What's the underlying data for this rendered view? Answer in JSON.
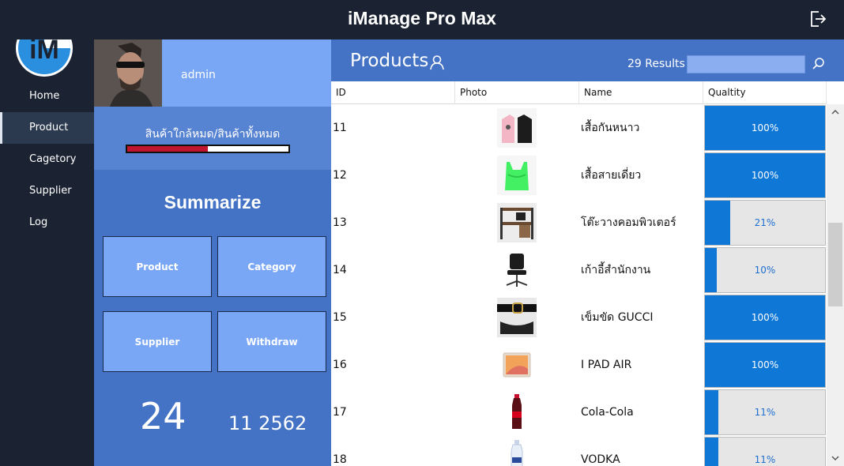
{
  "app": {
    "title": "iManage Pro Max",
    "logo_text": "iM"
  },
  "sidebar": {
    "items": [
      {
        "label": "Home",
        "active": false
      },
      {
        "label": "Product",
        "active": true
      },
      {
        "label": "Cagetory",
        "active": false
      },
      {
        "label": "Supplier",
        "active": false
      },
      {
        "label": "Log",
        "active": false
      }
    ]
  },
  "profile": {
    "username": "admin"
  },
  "stock": {
    "label": "สินค้าใกล้หมด/สินค้าทั้งหมด",
    "fraction": 0.5
  },
  "summary": {
    "title": "Summarize",
    "tiles": [
      "Product",
      "Category",
      "Supplier",
      "Withdraw"
    ],
    "day": "24",
    "month_year": "11 2562"
  },
  "products": {
    "title": "Products",
    "results": "29 Results",
    "search_value": "",
    "columns": [
      "ID",
      "Photo",
      "Name",
      "Qualtity"
    ],
    "rows": [
      {
        "id": "11",
        "name": "เสื้อกันหนาว",
        "quality": "100%",
        "fraction": 1.0,
        "photo": "hoodie"
      },
      {
        "id": "12",
        "name": "เสื้อสายเดี่ยว",
        "quality": "100%",
        "fraction": 1.0,
        "photo": "tank-top"
      },
      {
        "id": "13",
        "name": "โต๊ะวางคอมพิวเตอร์",
        "quality": "21%",
        "fraction": 0.21,
        "photo": "desk"
      },
      {
        "id": "14",
        "name": "เก้าอี้สำนักงาน",
        "quality": "10%",
        "fraction": 0.1,
        "photo": "office-chair"
      },
      {
        "id": "15",
        "name": "เข็มขัด GUCCI",
        "quality": "100%",
        "fraction": 1.0,
        "photo": "belt"
      },
      {
        "id": "16",
        "name": "I PAD AIR",
        "quality": "100%",
        "fraction": 1.0,
        "photo": "tablet"
      },
      {
        "id": "17",
        "name": "Cola-Cola",
        "quality": "11%",
        "fraction": 0.11,
        "photo": "cola-bottle"
      },
      {
        "id": "18",
        "name": "VODKA",
        "quality": "11%",
        "fraction": 0.11,
        "photo": "vodka-bottle"
      }
    ]
  },
  "colors": {
    "dark": "#1b2332",
    "panel": "#4472c4",
    "light_panel": "#7aa6f6",
    "bar_fill": "#0f78d7",
    "stock_fill": "#c0152f"
  }
}
